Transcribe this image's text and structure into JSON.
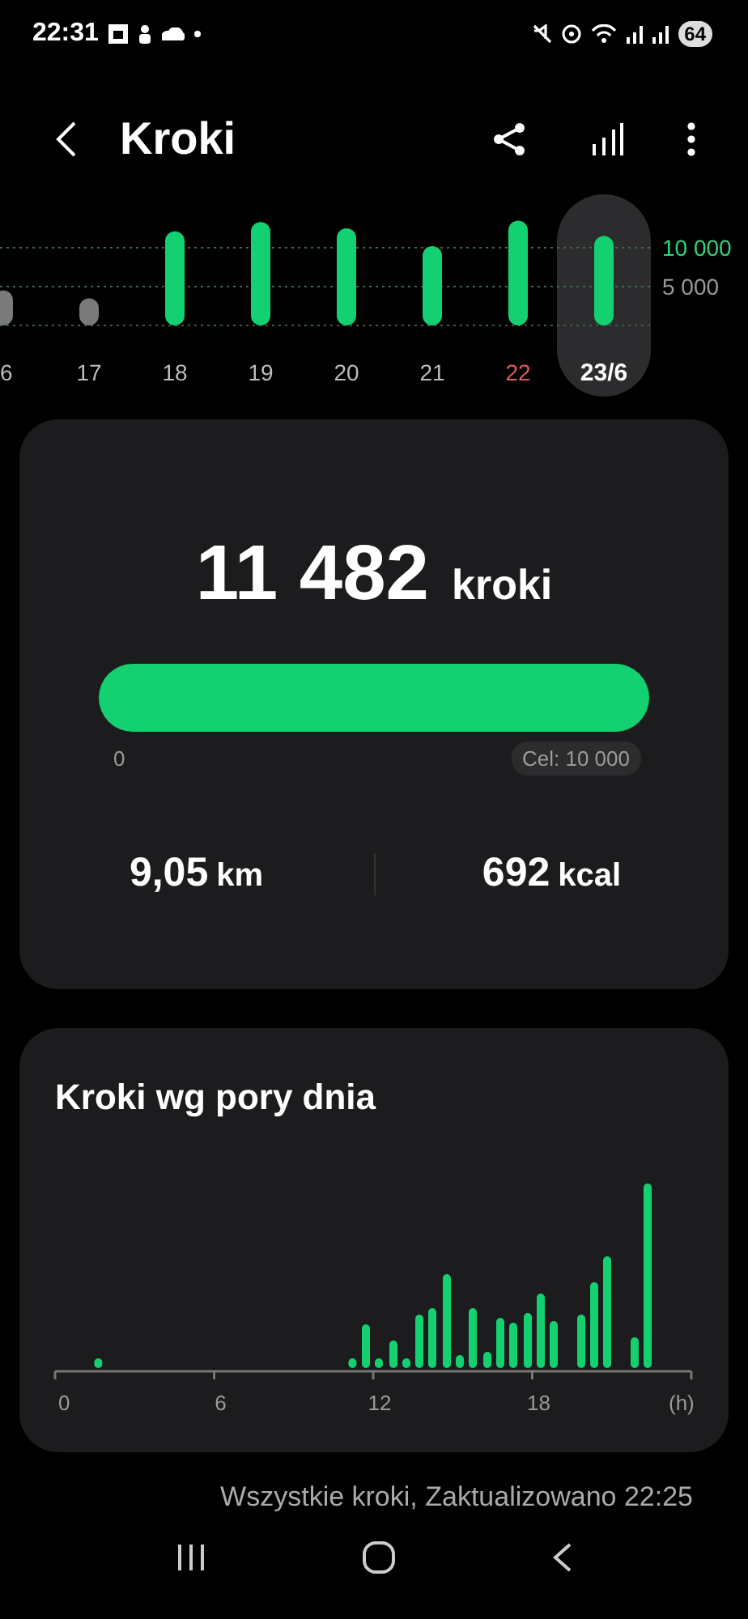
{
  "status_bar": {
    "time": "22:31",
    "battery": "64"
  },
  "header": {
    "title": "Kroki"
  },
  "day_strip": {
    "chart_data": {
      "type": "bar",
      "categories": [
        "6",
        "17",
        "18",
        "19",
        "20",
        "21",
        "22",
        "23/6"
      ],
      "values": [
        4500,
        3500,
        12100,
        13300,
        12500,
        10200,
        13500,
        11500
      ],
      "ylim": [
        0,
        14000
      ],
      "yticks": [
        {
          "value": 5000,
          "label": "5 000"
        },
        {
          "value": 10000,
          "label": "10 000"
        }
      ]
    },
    "days": [
      {
        "selected": false,
        "sunday": false
      },
      {
        "selected": false,
        "sunday": false
      },
      {
        "selected": false,
        "sunday": false
      },
      {
        "selected": false,
        "sunday": false
      },
      {
        "selected": false,
        "sunday": false
      },
      {
        "selected": false,
        "sunday": false
      },
      {
        "selected": false,
        "sunday": true
      },
      {
        "selected": true,
        "sunday": false
      }
    ]
  },
  "summary": {
    "steps": "11 482",
    "unit": "kroki",
    "level": 1,
    "start_label": "0",
    "goal_label": "Cel: 10 000",
    "distance": "9,05",
    "distance_unit": "km",
    "energy": "692",
    "energy_unit": "kcal"
  },
  "hourly": {
    "title": "Kroki wg pory dnia",
    "ticks": [
      "0",
      "6",
      "12",
      "18",
      "(h)"
    ]
  },
  "footer": "Wszystkie kroki, Zaktualizowano 22:25"
}
